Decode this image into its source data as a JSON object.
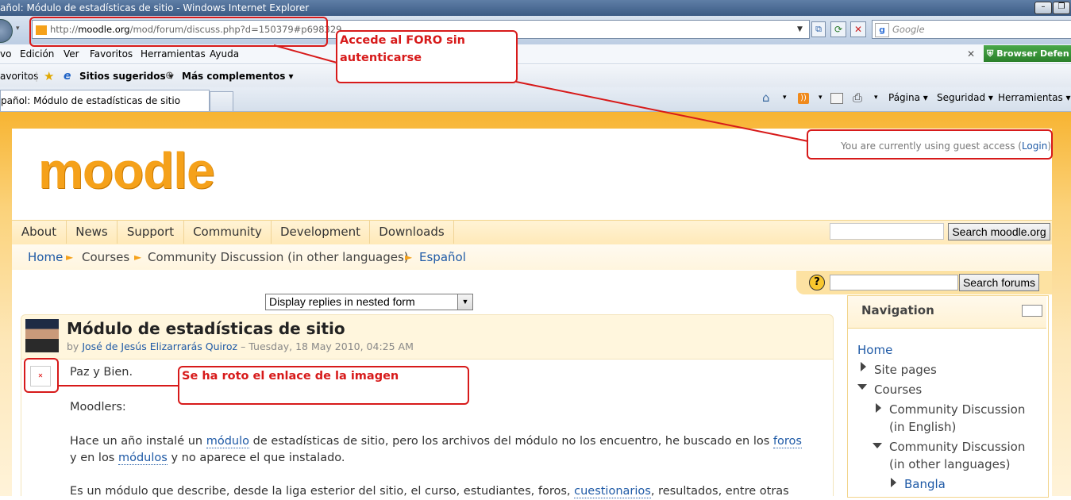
{
  "window": {
    "title": "añol: Módulo de estadísticas de sitio - Windows Internet Explorer"
  },
  "address": {
    "prefix": "http://",
    "domain": "moodle.org",
    "path": "/mod/forum/discuss.php?d=150379#p698329",
    "search_placeholder": "Google"
  },
  "menu": [
    "vo",
    "Edición",
    "Ver",
    "Favoritos",
    "Herramientas",
    "Ayuda"
  ],
  "addon": {
    "label": "Browser Defen"
  },
  "favbar": {
    "favorites": "avoritos",
    "suggested": "Sitios sugeridos ▾",
    "more": "Más complementos ▾"
  },
  "tab": {
    "title": "pañol: Módulo de estadísticas de sitio"
  },
  "commandbar": {
    "page": "Página ▾",
    "security": "Seguridad ▾",
    "tools": "Herramientas ▾"
  },
  "site": {
    "logo": "moodle",
    "guest_text": "You are currently using guest access (",
    "login_label": "Login",
    "guest_close": ")",
    "nav": [
      "About",
      "News",
      "Support",
      "Community",
      "Development",
      "Downloads"
    ],
    "search_button": "Search moodle.org"
  },
  "breadcrumb": {
    "home": "Home",
    "sep": "►",
    "courses": "Courses",
    "community": "Community Discussion (in other languages)",
    "current": "Español"
  },
  "forum": {
    "help": "?",
    "search_button": "Search forums",
    "display_mode": "Display replies in nested form"
  },
  "post": {
    "title": "Módulo de estadísticas de sitio",
    "by_prefix": "by ",
    "author": "José de Jesús Elizarrarás Quiroz",
    "date": " – Tuesday, 18 May 2010, 04:25 AM",
    "p1": "Paz y Bien.",
    "p2": "Moodlers:",
    "p3a": "Hace un año instalé un ",
    "p3link1": "módulo",
    "p3b": " de estadísticas de sitio, pero los archivos del módulo no los encuentro, he buscado en los ",
    "p3link2": "foros",
    "p3c": "y en los ",
    "p3link3": "módulos",
    "p3d": " y no aparece el que instalado.",
    "p4a": "Es un módulo que describe, desde la liga esterior del sitio, el curso, estudiantes, foros, ",
    "p4link": "cuestionarios",
    "p4b": ", resultados, entre otras"
  },
  "navigation": {
    "title": "Navigation",
    "home": "Home",
    "site_pages": "Site pages",
    "courses": "Courses",
    "cd_english_1": "Community Discussion",
    "cd_english_2": "(in English)",
    "cd_other_1": "Community Discussion",
    "cd_other_2": "(in other languages)",
    "bangla": "Bangla"
  },
  "annotations": {
    "forum_note": "Accede al FORO sin autenticarse",
    "image_note": "Se ha roto el enlace de la imagen",
    "color": "#d71a1a"
  }
}
